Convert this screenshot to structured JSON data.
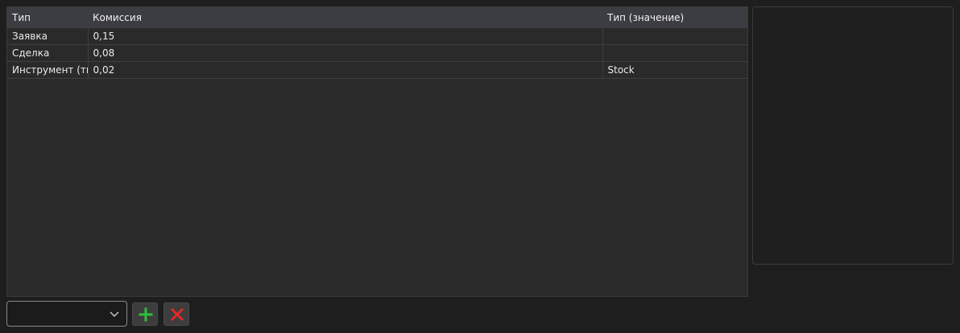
{
  "grid": {
    "columns": [
      "Тип",
      "Комиссия",
      "Тип (значение)"
    ],
    "rows": [
      [
        "Заявка",
        "0,15",
        ""
      ],
      [
        "Сделка",
        "0,08",
        ""
      ],
      [
        "Инструмент (тип)",
        "0,02",
        "Stock"
      ]
    ]
  },
  "toolbar": {
    "combo_value": "",
    "add_icon": "plus-icon",
    "remove_icon": "close-icon",
    "add_color": "#2fbf3a",
    "remove_color": "#e0282a"
  }
}
